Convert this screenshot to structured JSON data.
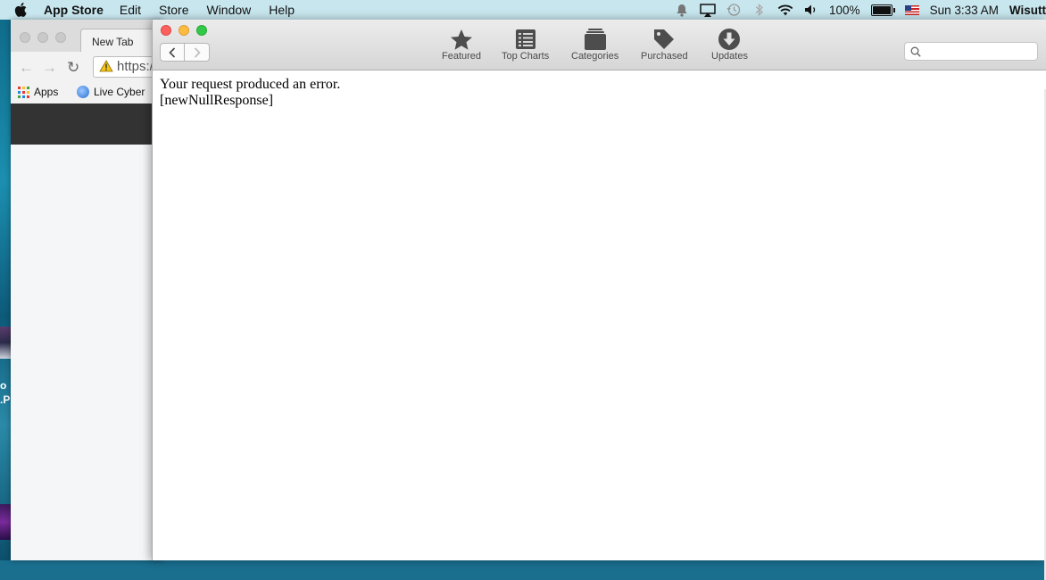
{
  "menubar": {
    "app_name": "App Store",
    "items": [
      "Edit",
      "Store",
      "Window",
      "Help"
    ],
    "battery": "100%",
    "clock": "Sun 3:33 AM",
    "user": "Wisutt"
  },
  "desktop": {
    "partial_text": "o\n.P"
  },
  "chrome": {
    "tab_title": "New Tab",
    "url_text": "https:/",
    "bookmarks": [
      "Apps",
      "Live Cyber"
    ]
  },
  "appstore": {
    "toolbar": {
      "items": [
        {
          "label": "Featured",
          "icon": "star-icon"
        },
        {
          "label": "Top Charts",
          "icon": "list-icon"
        },
        {
          "label": "Categories",
          "icon": "stack-icon"
        },
        {
          "label": "Purchased",
          "icon": "tag-icon"
        },
        {
          "label": "Updates",
          "icon": "download-icon"
        }
      ],
      "search_value": ""
    },
    "content": {
      "error_line": "Your request produced an error.",
      "error_code": "[newNullResponse]"
    }
  }
}
